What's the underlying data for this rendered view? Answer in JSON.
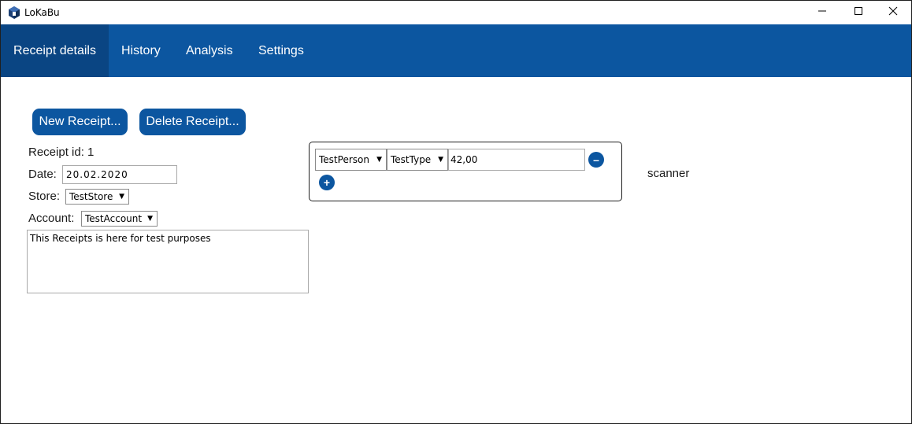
{
  "window": {
    "title": "LoKaBu"
  },
  "nav": {
    "tabs": [
      {
        "label": "Receipt details",
        "active": true
      },
      {
        "label": "History",
        "active": false
      },
      {
        "label": "Analysis",
        "active": false
      },
      {
        "label": "Settings",
        "active": false
      }
    ]
  },
  "actions": {
    "new_receipt": "New Receipt...",
    "delete_receipt": "Delete Receipt..."
  },
  "receipt": {
    "id_label": "Receipt id: 1",
    "date_label": "Date:",
    "date_value": "20.02.2020",
    "store_label": "Store:",
    "store_value": "TestStore",
    "account_label": "Account:",
    "account_value": "TestAccount",
    "notes": "This Receipts is here for test purposes"
  },
  "line_item": {
    "person": "TestPerson",
    "type": "TestType",
    "amount": "42,00",
    "remove_symbol": "–",
    "add_symbol": "+"
  },
  "scanner": {
    "label": "scanner"
  },
  "colors": {
    "accent": "#0c56a0",
    "accent_active": "#0a4583"
  },
  "icons": {
    "app": "cube-logo-icon",
    "minimize": "minimize-icon",
    "maximize": "maximize-icon",
    "close": "close-icon",
    "dropdown": "dropdown-arrow-icon"
  }
}
